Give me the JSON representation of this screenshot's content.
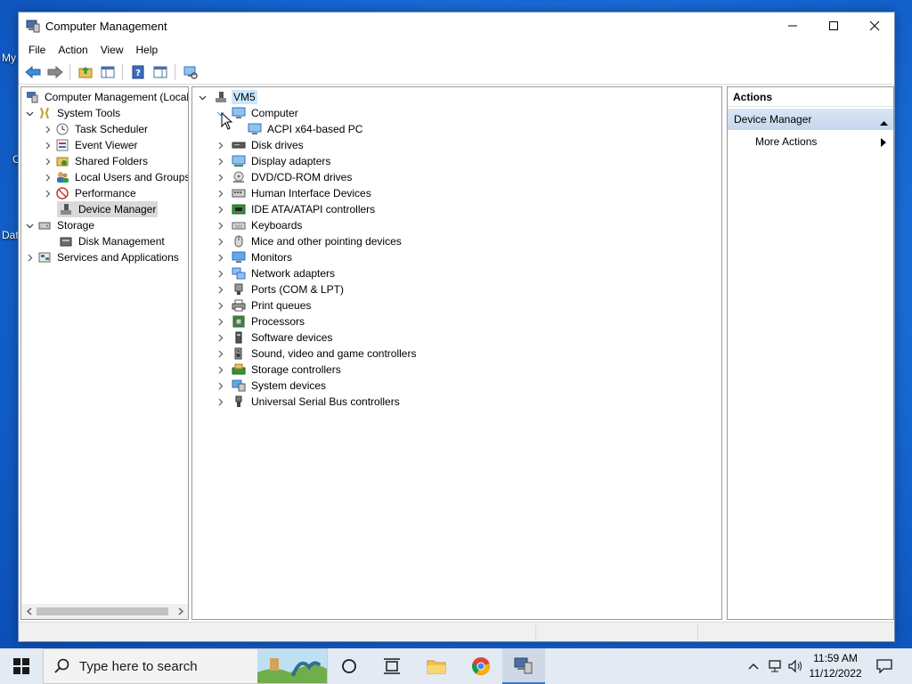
{
  "desktop": {
    "label_top": "My",
    "label_bottom": "Dat",
    "label_c": "C"
  },
  "window": {
    "title": "Computer Management"
  },
  "menu": [
    "File",
    "Action",
    "View",
    "Help"
  ],
  "tree": {
    "root": "Computer Management (Local",
    "system_tools": "System Tools",
    "task_scheduler": "Task Scheduler",
    "event_viewer": "Event Viewer",
    "shared_folders": "Shared Folders",
    "local_users": "Local Users and Groups",
    "performance": "Performance",
    "device_manager": "Device Manager",
    "storage": "Storage",
    "disk_management": "Disk Management",
    "services": "Services and Applications"
  },
  "devices": {
    "root": "VM5",
    "computer": "Computer",
    "computer_child": "ACPI x64-based PC",
    "categories": [
      {
        "label": "Disk drives",
        "icon": "disk-drive-icon"
      },
      {
        "label": "Display adapters",
        "icon": "display-adapter-icon"
      },
      {
        "label": "DVD/CD-ROM drives",
        "icon": "dvd-drive-icon"
      },
      {
        "label": "Human Interface Devices",
        "icon": "hid-icon"
      },
      {
        "label": "IDE ATA/ATAPI controllers",
        "icon": "ide-controller-icon"
      },
      {
        "label": "Keyboards",
        "icon": "keyboard-icon"
      },
      {
        "label": "Mice and other pointing devices",
        "icon": "mouse-icon"
      },
      {
        "label": "Monitors",
        "icon": "monitor-icon"
      },
      {
        "label": "Network adapters",
        "icon": "network-adapter-icon"
      },
      {
        "label": "Ports (COM & LPT)",
        "icon": "port-icon"
      },
      {
        "label": "Print queues",
        "icon": "printer-icon"
      },
      {
        "label": "Processors",
        "icon": "processor-icon"
      },
      {
        "label": "Software devices",
        "icon": "software-device-icon"
      },
      {
        "label": "Sound, video and game controllers",
        "icon": "speaker-icon"
      },
      {
        "label": "Storage controllers",
        "icon": "storage-controller-icon"
      },
      {
        "label": "System devices",
        "icon": "system-device-icon"
      },
      {
        "label": "Universal Serial Bus controllers",
        "icon": "usb-icon"
      }
    ]
  },
  "actions": {
    "header": "Actions",
    "section": "Device Manager",
    "more": "More Actions"
  },
  "taskbar": {
    "search_placeholder": "Type here to search",
    "time": "11:59 AM",
    "date": "11/12/2022"
  }
}
